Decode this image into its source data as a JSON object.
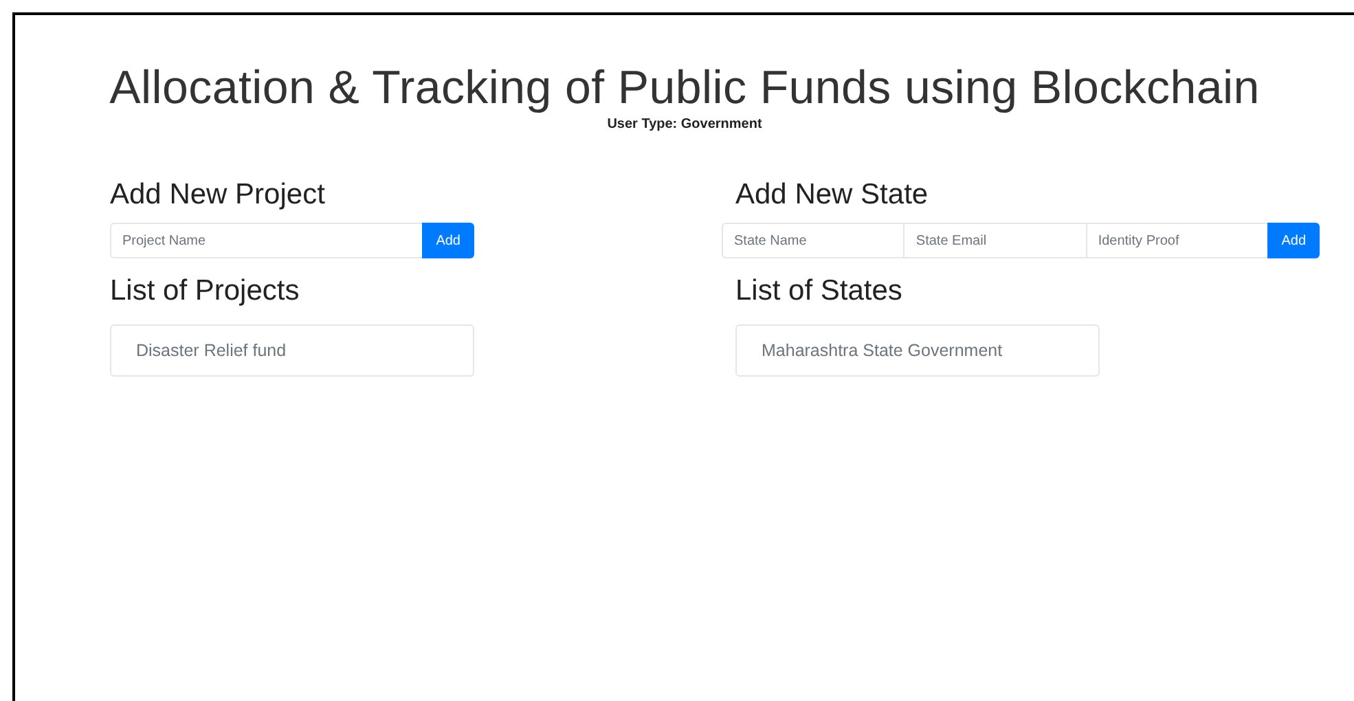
{
  "title": "Allocation & Tracking of Public Funds using Blockchain",
  "user_type": "User Type: Government",
  "projects": {
    "heading": "Add New Project",
    "fields": [
      {
        "placeholder": "Project Name"
      }
    ],
    "button": "Add",
    "list_heading": "List of Projects",
    "items": [
      "Disaster Relief fund"
    ]
  },
  "states": {
    "heading": "Add New State",
    "fields": [
      {
        "placeholder": "State Name"
      },
      {
        "placeholder": "State Email"
      },
      {
        "placeholder": "Identity Proof"
      }
    ],
    "button": "Add",
    "list_heading": "List of States",
    "items": [
      "Maharashtra State Government"
    ]
  }
}
